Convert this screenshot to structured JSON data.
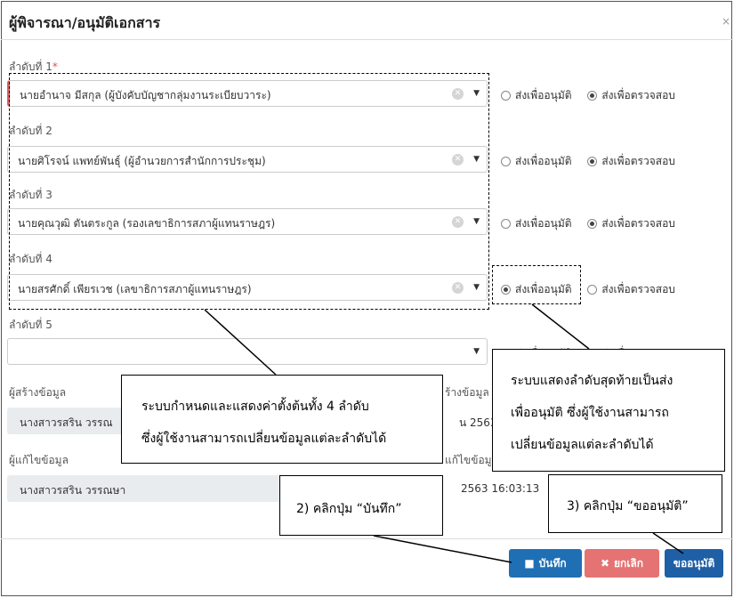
{
  "dialog": {
    "title": "ผู้พิจารณา/อนุมัติเอกสาร",
    "close_label": "×"
  },
  "approvers": [
    {
      "label": "ลำดับที่ 1",
      "required": "*",
      "value": "นายอำนาจ มีสกุล (ผู้บังคับบัญชากลุ่มงานระเบียบวาระ)",
      "selected_option": "ส่งเพื่อตรวจสอบ"
    },
    {
      "label": "ลำดับที่ 2",
      "value": "นายศิโรจน์ แพทย์พันธุ์ (ผู้อำนวยการสำนักการประชุม)",
      "selected_option": "ส่งเพื่อตรวจสอบ"
    },
    {
      "label": "ลำดับที่ 3",
      "value": "นายคุณวุฒิ ตันตระกูล (รองเลขาธิการสภาผู้แทนราษฎร)",
      "selected_option": "ส่งเพื่อตรวจสอบ"
    },
    {
      "label": "ลำดับที่ 4",
      "value": "นายสรศักดิ์ เพียรเวช (เลขาธิการสภาผู้แทนราษฎร)",
      "selected_option": "ส่งเพื่ออนุมัติ"
    },
    {
      "label": "ลำดับที่ 5",
      "value": "",
      "selected_option": ""
    }
  ],
  "options": {
    "approve": "ส่งเพื่ออนุมัติ",
    "review": "ส่งเพื่อตรวจสอบ"
  },
  "created": {
    "label": "ผู้สร้างข้อมูล",
    "value": "นางสาวรสริน วรรณ",
    "date_label": "ร้างข้อมูล",
    "date_value": "น 2563"
  },
  "modified": {
    "label": "ผู้แก้ไขข้อมูล",
    "value": "นางสาวรสริน วรรณษา",
    "date_label": "แก้ไขข้อมูล",
    "date_value": "2563 16:03:13"
  },
  "buttons": {
    "save": "บันทึก",
    "cancel": "ยกเลิก",
    "approve": "ขออนุมัติ"
  },
  "annotations": {
    "left_line1": "ระบบกำหนดและแสดงค่าตั้งต้นทั้ง 4 ลำดับ",
    "left_line2": "ซึ่งผู้ใช้งานสามารถเปลี่ยนข้อมูลแต่ละลำดับได้",
    "right_line1": "ระบบแสดงลำดับสุดท้ายเป็นส่ง",
    "right_line2": "เพื่ออนุมัติ ซึ่งผู้ใช้งานสามารถ",
    "right_line3": "เปลี่ยนข้อมูลแต่ละลำดับได้",
    "save_note": "2) คลิกปุ่ม “บันทึก”",
    "approve_note": "3) คลิกปุ่ม “ขออนุมัติ”"
  }
}
